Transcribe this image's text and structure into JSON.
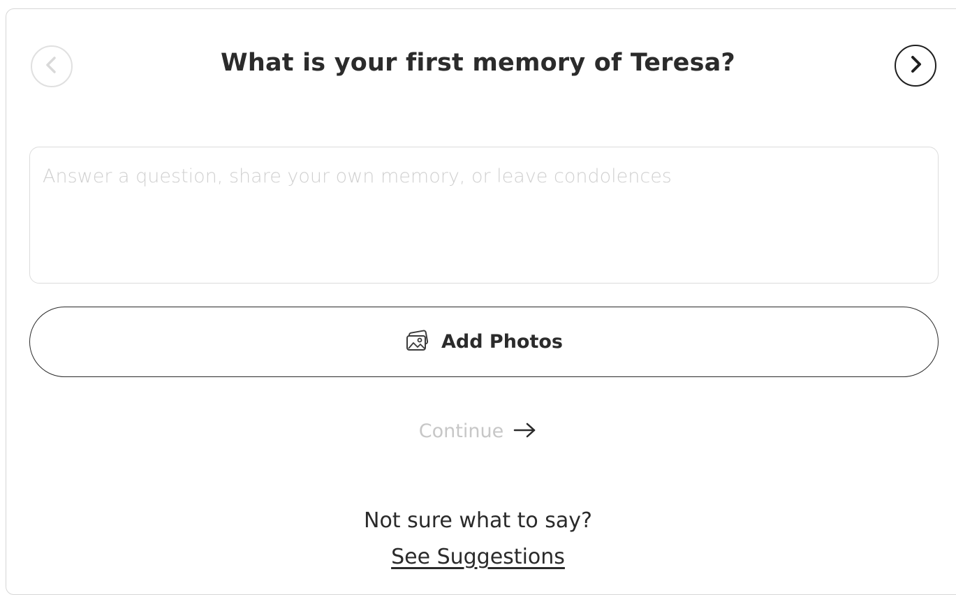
{
  "question": {
    "title": "What is your first memory of Teresa?",
    "prev_icon": "chevron-left-icon",
    "next_icon": "chevron-right-icon"
  },
  "answer": {
    "placeholder": "Answer a question, share your own memory, or leave condolences",
    "value": ""
  },
  "photos": {
    "button_label": "Add Photos",
    "icon": "photos-icon"
  },
  "continue": {
    "label": "Continue",
    "icon": "arrow-right-icon",
    "state": "disabled"
  },
  "help": {
    "prompt": "Not sure what to say?",
    "link_label": "See Suggestions"
  },
  "colors": {
    "text": "#2a2a2a",
    "disabled_text": "#c7c7c7",
    "border": "#dcdcdc",
    "prev_button_border": "#e0e0e0",
    "next_button_border": "#1f1f1f"
  }
}
